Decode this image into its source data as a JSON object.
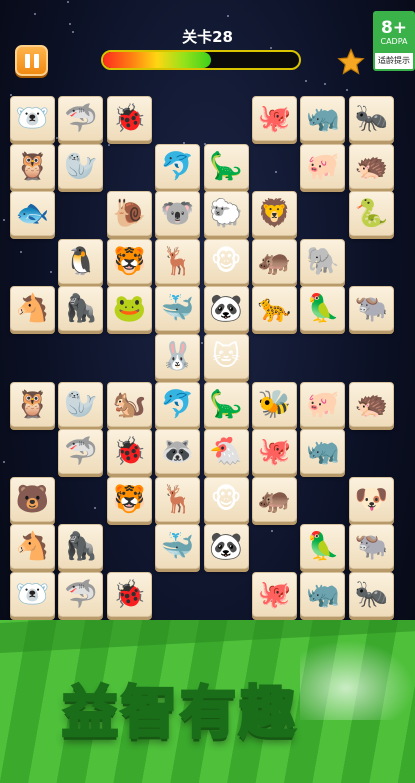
{
  "header": {
    "level_title": "关卡28",
    "progress_fraction": 0.55,
    "pause_icon": "pause-icon",
    "star_icon": "star-icon",
    "star_color": "#f5a623"
  },
  "age_rating": {
    "age": "8+",
    "org": "CADPA",
    "tip": "适龄提示"
  },
  "colors": {
    "tile_bg": "#f5e7cc",
    "pause_bg": "#f59a1f",
    "grass_light": "#4ec03a",
    "grass_dark": "#3aa92c"
  },
  "board": {
    "tiles": [
      {
        "row": 0,
        "col": 0,
        "animal": "polar-bear",
        "glyph": "🐻‍❄️"
      },
      {
        "row": 0,
        "col": 1,
        "animal": "shark",
        "glyph": "🦈"
      },
      {
        "row": 0,
        "col": 2,
        "animal": "ladybug",
        "glyph": "🐞"
      },
      {
        "row": 0,
        "col": 5,
        "animal": "octopus",
        "glyph": "🐙"
      },
      {
        "row": 0,
        "col": 6,
        "animal": "rhino",
        "glyph": "🦏"
      },
      {
        "row": 0,
        "col": 7,
        "animal": "ant",
        "glyph": "🐜"
      },
      {
        "row": 1,
        "col": 0,
        "animal": "owl",
        "glyph": "🦉"
      },
      {
        "row": 1,
        "col": 1,
        "animal": "seal",
        "glyph": "🦭"
      },
      {
        "row": 1,
        "col": 3,
        "animal": "dolphin",
        "glyph": "🐬"
      },
      {
        "row": 1,
        "col": 4,
        "animal": "dinosaur",
        "glyph": "🦕"
      },
      {
        "row": 1,
        "col": 6,
        "animal": "pig",
        "glyph": "🐖"
      },
      {
        "row": 1,
        "col": 7,
        "animal": "hedgehog",
        "glyph": "🦔"
      },
      {
        "row": 2,
        "col": 0,
        "animal": "fish",
        "glyph": "🐟"
      },
      {
        "row": 2,
        "col": 2,
        "animal": "snail",
        "glyph": "🐌"
      },
      {
        "row": 2,
        "col": 3,
        "animal": "koala",
        "glyph": "🐨"
      },
      {
        "row": 2,
        "col": 4,
        "animal": "sheep",
        "glyph": "🐑"
      },
      {
        "row": 2,
        "col": 5,
        "animal": "lion",
        "glyph": "🦁"
      },
      {
        "row": 2,
        "col": 7,
        "animal": "snake",
        "glyph": "🐍"
      },
      {
        "row": 3,
        "col": 1,
        "animal": "penguin",
        "glyph": "🐧"
      },
      {
        "row": 3,
        "col": 2,
        "animal": "tiger",
        "glyph": "🐯"
      },
      {
        "row": 3,
        "col": 3,
        "animal": "deer",
        "glyph": "🦌"
      },
      {
        "row": 3,
        "col": 4,
        "animal": "monkey",
        "glyph": "🐵"
      },
      {
        "row": 3,
        "col": 5,
        "animal": "hippo",
        "glyph": "🦛"
      },
      {
        "row": 3,
        "col": 6,
        "animal": "elephant",
        "glyph": "🐘"
      },
      {
        "row": 4,
        "col": 0,
        "animal": "horse",
        "glyph": "🐴"
      },
      {
        "row": 4,
        "col": 1,
        "animal": "gorilla",
        "glyph": "🦍"
      },
      {
        "row": 4,
        "col": 2,
        "animal": "frog",
        "glyph": "🐸"
      },
      {
        "row": 4,
        "col": 3,
        "animal": "whale",
        "glyph": "🐳"
      },
      {
        "row": 4,
        "col": 4,
        "animal": "panda",
        "glyph": "🐼"
      },
      {
        "row": 4,
        "col": 5,
        "animal": "leopard",
        "glyph": "🐆"
      },
      {
        "row": 4,
        "col": 6,
        "animal": "parrot",
        "glyph": "🦜"
      },
      {
        "row": 4,
        "col": 7,
        "animal": "yak",
        "glyph": "🐃"
      },
      {
        "row": 5,
        "col": 3,
        "animal": "rabbit",
        "glyph": "🐰"
      },
      {
        "row": 5,
        "col": 4,
        "animal": "cat",
        "glyph": "🐱"
      },
      {
        "row": 6,
        "col": 0,
        "animal": "owl",
        "glyph": "🦉"
      },
      {
        "row": 6,
        "col": 1,
        "animal": "seal",
        "glyph": "🦭"
      },
      {
        "row": 6,
        "col": 2,
        "animal": "squirrel",
        "glyph": "🐿️"
      },
      {
        "row": 6,
        "col": 3,
        "animal": "dolphin",
        "glyph": "🐬"
      },
      {
        "row": 6,
        "col": 4,
        "animal": "dinosaur",
        "glyph": "🦕"
      },
      {
        "row": 6,
        "col": 5,
        "animal": "bee",
        "glyph": "🐝"
      },
      {
        "row": 6,
        "col": 6,
        "animal": "pig",
        "glyph": "🐖"
      },
      {
        "row": 6,
        "col": 7,
        "animal": "hedgehog",
        "glyph": "🦔"
      },
      {
        "row": 7,
        "col": 1,
        "animal": "shark",
        "glyph": "🦈"
      },
      {
        "row": 7,
        "col": 2,
        "animal": "ladybug",
        "glyph": "🐞"
      },
      {
        "row": 7,
        "col": 3,
        "animal": "raccoon",
        "glyph": "🦝"
      },
      {
        "row": 7,
        "col": 4,
        "animal": "chicken",
        "glyph": "🐔"
      },
      {
        "row": 7,
        "col": 5,
        "animal": "octopus",
        "glyph": "🐙"
      },
      {
        "row": 7,
        "col": 6,
        "animal": "rhino",
        "glyph": "🦏"
      },
      {
        "row": 8,
        "col": 0,
        "animal": "bear",
        "glyph": "🐻"
      },
      {
        "row": 8,
        "col": 2,
        "animal": "tiger",
        "glyph": "🐯"
      },
      {
        "row": 8,
        "col": 3,
        "animal": "deer",
        "glyph": "🦌"
      },
      {
        "row": 8,
        "col": 4,
        "animal": "monkey",
        "glyph": "🐵"
      },
      {
        "row": 8,
        "col": 5,
        "animal": "hippo",
        "glyph": "🦛"
      },
      {
        "row": 8,
        "col": 7,
        "animal": "dog",
        "glyph": "🐶"
      },
      {
        "row": 9,
        "col": 0,
        "animal": "horse",
        "glyph": "🐴"
      },
      {
        "row": 9,
        "col": 1,
        "animal": "gorilla",
        "glyph": "🦍"
      },
      {
        "row": 9,
        "col": 3,
        "animal": "whale",
        "glyph": "🐳"
      },
      {
        "row": 9,
        "col": 4,
        "animal": "panda",
        "glyph": "🐼"
      },
      {
        "row": 9,
        "col": 6,
        "animal": "parrot",
        "glyph": "🦜"
      },
      {
        "row": 9,
        "col": 7,
        "animal": "yak",
        "glyph": "🐃"
      },
      {
        "row": 10,
        "col": 0,
        "animal": "polar-bear",
        "glyph": "🐻‍❄️"
      },
      {
        "row": 10,
        "col": 1,
        "animal": "shark",
        "glyph": "🦈"
      },
      {
        "row": 10,
        "col": 2,
        "animal": "ladybug",
        "glyph": "🐞"
      },
      {
        "row": 10,
        "col": 5,
        "animal": "octopus",
        "glyph": "🐙"
      },
      {
        "row": 10,
        "col": 6,
        "animal": "rhino",
        "glyph": "🦏"
      },
      {
        "row": 10,
        "col": 7,
        "animal": "ant",
        "glyph": "🐜"
      }
    ]
  },
  "banner": {
    "text": "益智有趣"
  }
}
